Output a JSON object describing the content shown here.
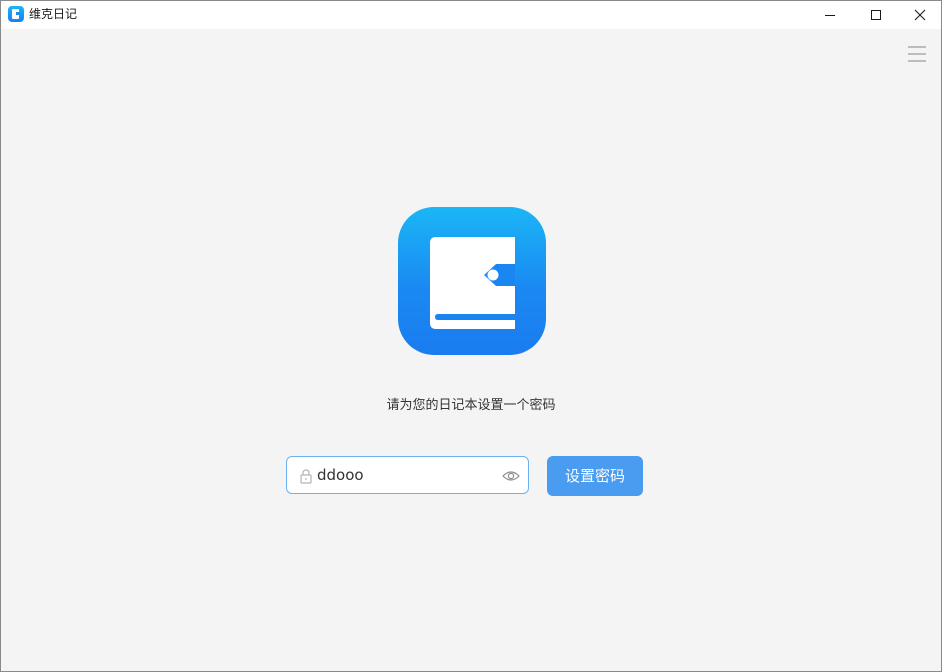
{
  "window": {
    "title": "维克日记",
    "controls": {
      "minimize_icon": "minimize-icon",
      "maximize_icon": "maximize-icon",
      "close_icon": "close-icon"
    }
  },
  "toolbar": {
    "menu_icon": "hamburger-menu-icon"
  },
  "main": {
    "logo_icon": "notebook-icon",
    "prompt": "请为您的日记本设置一个密码",
    "password": {
      "value": "ddooo",
      "lock_icon": "lock-icon",
      "visibility_icon": "eye-icon"
    },
    "set_button_label": "设置密码"
  },
  "colors": {
    "accent": "#4a9cf0",
    "logo_top": "#1bb6f6",
    "logo_bottom": "#1a7cf0",
    "background": "#f4f4f4",
    "input_border": "#6ab2f2"
  }
}
